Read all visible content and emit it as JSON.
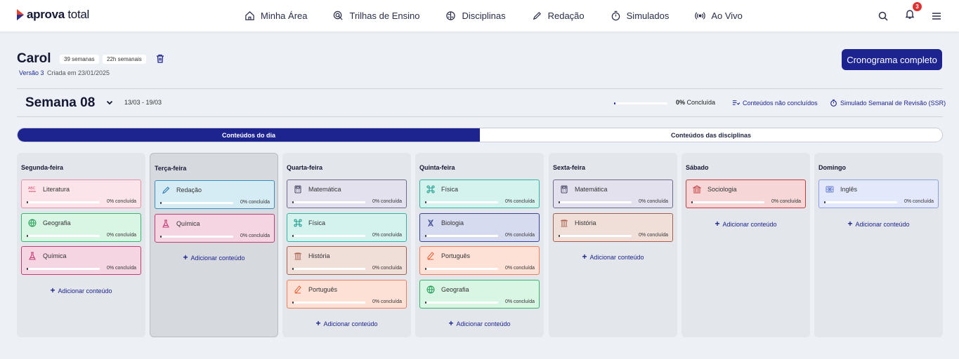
{
  "brand": {
    "name_bold": "aprova",
    "name_light": " total"
  },
  "nav": [
    {
      "label": "Minha Área",
      "icon": "home-icon"
    },
    {
      "label": "Trilhas de Ensino",
      "icon": "target-pointer-icon"
    },
    {
      "label": "Disciplinas",
      "icon": "brain-icon"
    },
    {
      "label": "Redação",
      "icon": "pencil-icon"
    },
    {
      "label": "Simulados",
      "icon": "stopwatch-icon"
    },
    {
      "label": "Ao Vivo",
      "icon": "broadcast-icon"
    }
  ],
  "notifications": {
    "count": "3"
  },
  "plan": {
    "name": "Carol",
    "weeks": "39 semanas",
    "hours": "22h semanais",
    "version": "Versão 3",
    "created": "Criada em 23/01/2025",
    "full_schedule_label": "Cronograma completo"
  },
  "week": {
    "title": "Semana 08",
    "range": "13/03 - 19/03",
    "progress": 0.02,
    "pct_value": "0%",
    "pct_label": " Concluída",
    "not_done_label": "Conteúdos não concluídos",
    "ssr_label": "Simulado Semanal de Revisão (SSR)"
  },
  "tabs": [
    {
      "label": "Conteúdos do dia",
      "active": true
    },
    {
      "label": "Conteúdos das disciplinas",
      "active": false
    }
  ],
  "add_label": "Adicionar conteúdo",
  "pct_text": "0% concluída",
  "subject_colors": {
    "Literatura": {
      "bg": "#fbe4ea",
      "border": "#e88fa6",
      "icon": "#d9466b"
    },
    "Geografia": {
      "bg": "#d9f5e4",
      "border": "#33b76a",
      "icon": "#1f9e52"
    },
    "Química": {
      "bg": "#f6d5e3",
      "border": "#c43a74",
      "icon": "#c43a74"
    },
    "Redação": {
      "bg": "#d6ecf5",
      "border": "#3c8dbc",
      "icon": "#2c7bb0"
    },
    "Matemática": {
      "bg": "#e2e1ed",
      "border": "#6b6a8c",
      "icon": "#4c4b6b"
    },
    "Física": {
      "bg": "#d4f3ef",
      "border": "#2fb5a4",
      "icon": "#1f9e8e"
    },
    "História": {
      "bg": "#f0dfd9",
      "border": "#a65f4a",
      "icon": "#a65f4a"
    },
    "Português": {
      "bg": "#fde0d6",
      "border": "#f07d55",
      "icon": "#e8663a"
    },
    "Biologia": {
      "bg": "#d7dbf0",
      "border": "#3a4593",
      "icon": "#3a4593"
    },
    "Sociologia": {
      "bg": "#f6d6d6",
      "border": "#c43b3b",
      "icon": "#c43b3b"
    },
    "Inglês": {
      "bg": "#e3e8fb",
      "border": "#8aa0e3",
      "icon": "#6b82d1"
    }
  },
  "days": [
    {
      "name": "Segunda-feira",
      "selected": false,
      "subjects": [
        "Literatura",
        "Geografia",
        "Química"
      ]
    },
    {
      "name": "Terça-feira",
      "selected": true,
      "subjects": [
        "Redação",
        "Química"
      ]
    },
    {
      "name": "Quarta-feira",
      "selected": false,
      "subjects": [
        "Matemática",
        "Física",
        "História",
        "Português"
      ]
    },
    {
      "name": "Quinta-feira",
      "selected": false,
      "subjects": [
        "Física",
        "Biologia",
        "Português",
        "Geografia"
      ]
    },
    {
      "name": "Sexta-feira",
      "selected": false,
      "subjects": [
        "Matemática",
        "História"
      ]
    },
    {
      "name": "Sábado",
      "selected": false,
      "subjects": [
        "Sociologia"
      ]
    },
    {
      "name": "Domingo",
      "selected": false,
      "subjects": [
        "Inglês"
      ]
    }
  ]
}
